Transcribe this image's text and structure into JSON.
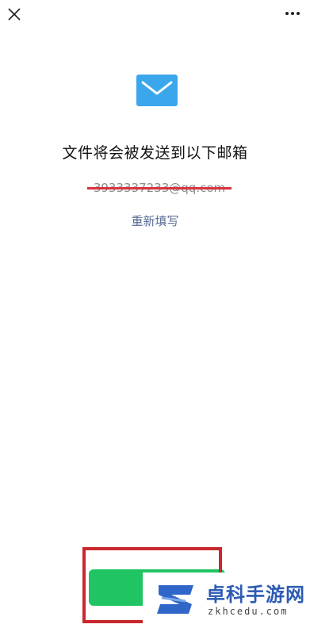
{
  "header": {
    "close_icon": "close-icon",
    "more_icon": "more-icon"
  },
  "main": {
    "mail_icon": "envelope-icon",
    "title": "文件将会被发送到以下邮箱",
    "email": "3933337233@qq.com",
    "rewrite_link": "重新填写"
  },
  "footer": {
    "confirm_button_label": ""
  },
  "watermark": {
    "title": "卓科手游网",
    "subtitle": "zkhcedu.com"
  },
  "colors": {
    "accent_blue": "#3aa7ec",
    "link": "#576b95",
    "confirm_green": "#20c463",
    "highlight_red": "#c9282d"
  }
}
